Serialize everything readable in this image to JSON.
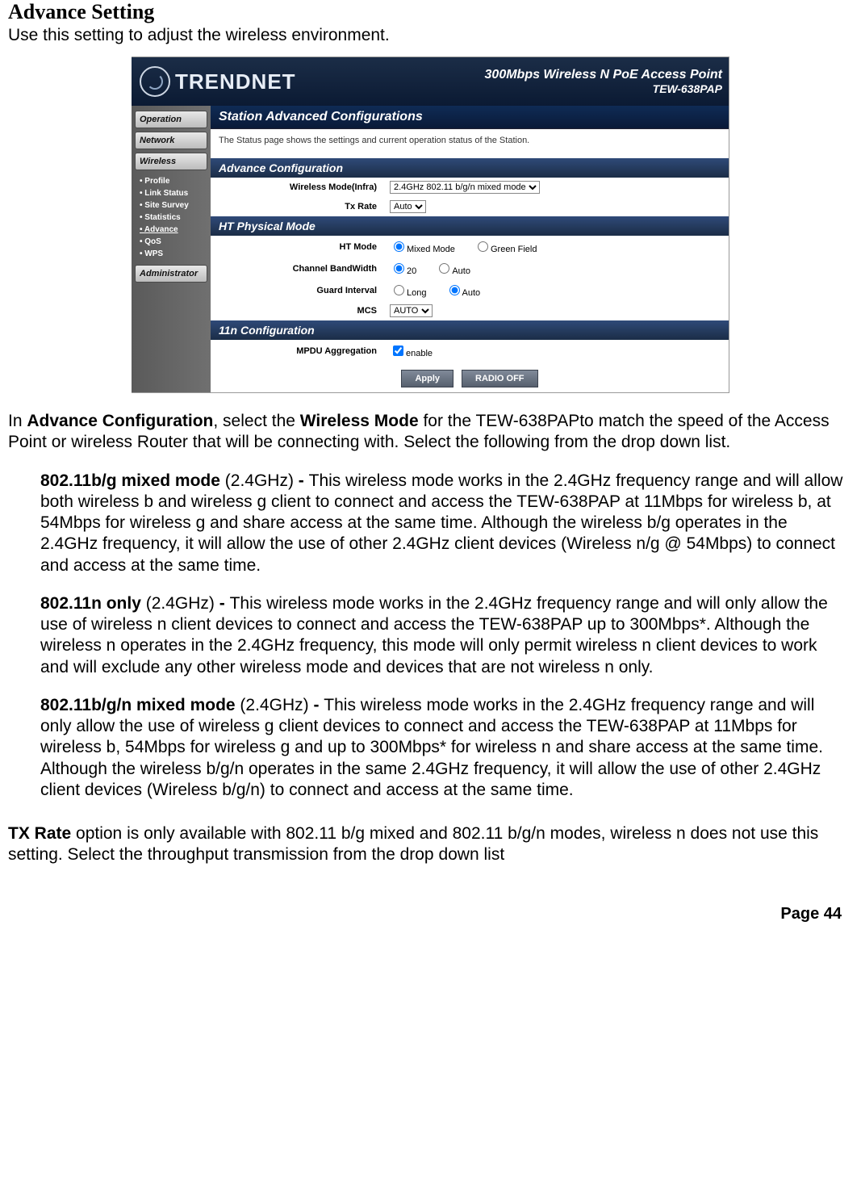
{
  "page": {
    "title": "Advance Setting",
    "subtitle": "Use this setting to adjust the wireless environment.",
    "footer": "Page  44"
  },
  "router": {
    "brand": "TRENDNET",
    "header_line1": "300Mbps Wireless N PoE Access Point",
    "header_line2": "TEW-638PAP",
    "nav": {
      "operation": "Operation",
      "network": "Network",
      "wireless": "Wireless",
      "administrator": "Administrator",
      "sub": {
        "profile": "Profile",
        "link_status": "Link Status",
        "site_survey": "Site Survey",
        "statistics": "Statistics",
        "advance": "Advance",
        "qos": "QoS",
        "wps": "WPS"
      }
    },
    "content": {
      "main_title": "Station Advanced Configurations",
      "desc": "The Status page shows the settings and current operation status of the Station.",
      "adv_title": "Advance Configuration",
      "wireless_mode_label": "Wireless Mode(Infra)",
      "wireless_mode_value": "2.4GHz 802.11 b/g/n mixed mode",
      "tx_rate_label": "Tx Rate",
      "tx_rate_value": "Auto",
      "ht_title": "HT Physical Mode",
      "ht_mode_label": "HT Mode",
      "ht_mixed": "Mixed Mode",
      "ht_green": "Green Field",
      "cbw_label": "Channel BandWidth",
      "cbw_20": "20",
      "cbw_auto": "Auto",
      "gi_label": "Guard Interval",
      "gi_long": "Long",
      "gi_auto": "Auto",
      "mcs_label": "MCS",
      "mcs_value": "AUTO",
      "n_title": "11n Configuration",
      "mpdu_label": "MPDU Aggregation",
      "mpdu_enable": "enable",
      "apply": "Apply",
      "radio_off": "RADIO OFF"
    }
  },
  "body": {
    "intro_a": "In ",
    "intro_b": "Advance Configuration",
    "intro_c": ", select the ",
    "intro_d": "Wireless Mode",
    "intro_e": " for the TEW-638PAPto match the speed of the Access Point or wireless Router that will be connecting with. Select the following from the drop down list.",
    "m1_a": "802.11b/g mixed mode",
    "m1_b": " (2.4GHz) ",
    "m1_c": "- ",
    "m1_d": "This wireless mode works in the 2.4GHz frequency range and will allow both wireless b and wireless g client to connect and access the TEW-638PAP at 11Mbps for wireless b, at 54Mbps for wireless g and share access at the same time. Although the wireless b/g operates in the 2.4GHz frequency, it will allow the use of other 2.4GHz client devices (Wireless n/g @ 54Mbps) to connect and access at the same time.",
    "m2_a": "802.11n only",
    "m2_b": " (2.4GHz) ",
    "m2_c": "- ",
    "m2_d": "This wireless mode works in the 2.4GHz frequency range and will only allow the use of wireless n client devices to connect and access the TEW-638PAP up to 300Mbps*. Although the wireless n operates in the 2.4GHz frequency, this mode will only permit wireless n client devices to work and will exclude any other wireless mode and devices that are not wireless n only.",
    "m3_a": "802.11b/g/n mixed mode",
    "m3_b": " (2.4GHz) ",
    "m3_c": "- ",
    "m3_d": "This wireless mode works in the 2.4GHz frequency range and will only allow the use of wireless g client devices to connect and access the TEW-638PAP at 11Mbps for wireless b, 54Mbps for wireless g and up to 300Mbps* for wireless n and share access at the same time. Although the wireless b/g/n operates in the same 2.4GHz frequency, it will allow the use of other 2.4GHz client devices (Wireless b/g/n) to connect and access at the same time.",
    "tx_a": "TX Rate",
    "tx_b": " option is only available with 802.11 b/g mixed and 802.11 b/g/n modes, wireless n does not use this setting. Select the throughput transmission from the drop down list"
  }
}
